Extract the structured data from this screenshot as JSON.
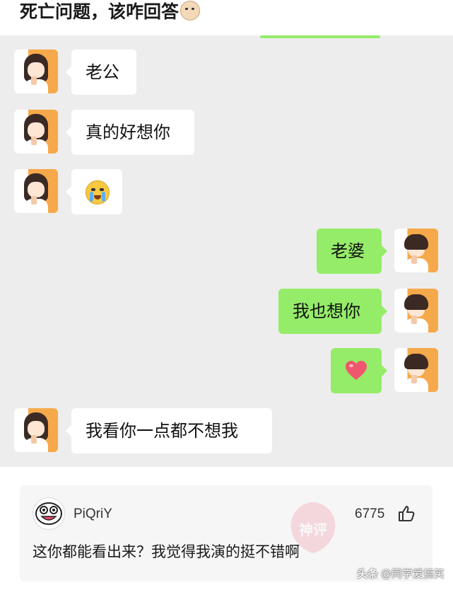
{
  "title": {
    "text": "死亡问题，该咋回答",
    "emoji": "face-emoji"
  },
  "messages": [
    {
      "side": "left",
      "text": "老公",
      "avatar": "girl-avatar"
    },
    {
      "side": "left",
      "text": "真的好想你",
      "avatar": "girl-avatar"
    },
    {
      "side": "left",
      "emoji": "crying-face-emoji",
      "avatar": "girl-avatar"
    },
    {
      "side": "right",
      "text": "老婆",
      "avatar": "boy-avatar"
    },
    {
      "side": "right",
      "text": "我也想你",
      "avatar": "boy-avatar"
    },
    {
      "side": "right",
      "emoji": "heart-emoji",
      "avatar": "boy-avatar"
    },
    {
      "side": "left",
      "text": "我看你一点都不想我",
      "avatar": "girl-avatar"
    }
  ],
  "comment": {
    "username": "PiQriY",
    "likes": "6775",
    "text": "这你都能看出来？我觉得我演的挺不错啊",
    "stamp": "神评"
  },
  "watermark": {
    "brand": "头条",
    "text": "@同学爱搞笑"
  },
  "colors": {
    "chat_bg": "#ededed",
    "bubble_right": "#95ec69",
    "bubble_left": "#ffffff"
  }
}
